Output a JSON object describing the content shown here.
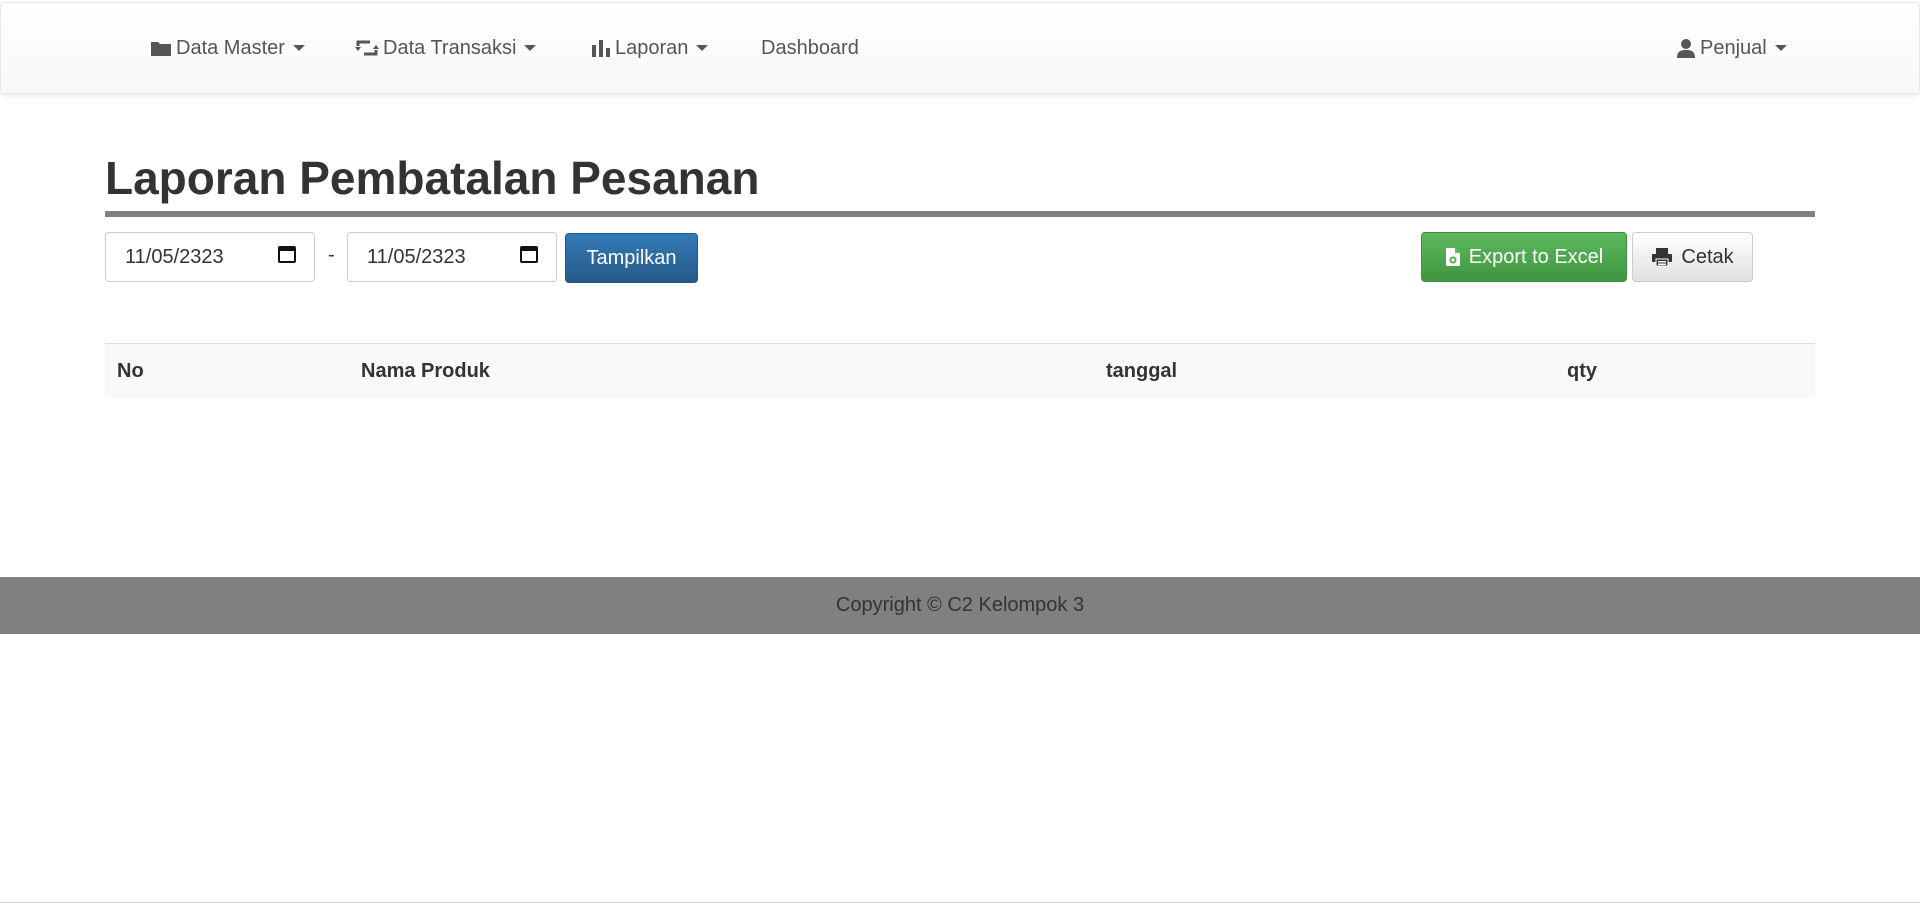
{
  "navbar": {
    "items": [
      {
        "label": "Data Master",
        "icon": "folder-icon",
        "dropdown": true
      },
      {
        "label": "Data Transaksi",
        "icon": "retweet-icon",
        "dropdown": true
      },
      {
        "label": "Laporan",
        "icon": "bar-chart-icon",
        "dropdown": true
      },
      {
        "label": "Dashboard",
        "dropdown": false
      }
    ],
    "user": {
      "label": "Penjual",
      "icon": "user-icon",
      "dropdown": true
    }
  },
  "page": {
    "title": "Laporan Pembatalan Pesanan"
  },
  "filter": {
    "date_from": "11/05/2323",
    "separator": "-",
    "date_to": "11/05/2323",
    "submit_label": "Tampilkan"
  },
  "actions": {
    "export_label": "Export to Excel",
    "export_icon": "file-excel-icon",
    "print_label": "Cetak",
    "print_icon": "print-icon"
  },
  "table": {
    "columns": [
      "No",
      "Nama Produk",
      "tanggal",
      "qty"
    ],
    "rows": []
  },
  "footer": {
    "text": "Copyright © C2 Kelompok 3"
  },
  "colors": {
    "primary": "#337ab7",
    "success": "#5cb85c",
    "footer_bg": "#808080",
    "title_rule": "#808080"
  }
}
